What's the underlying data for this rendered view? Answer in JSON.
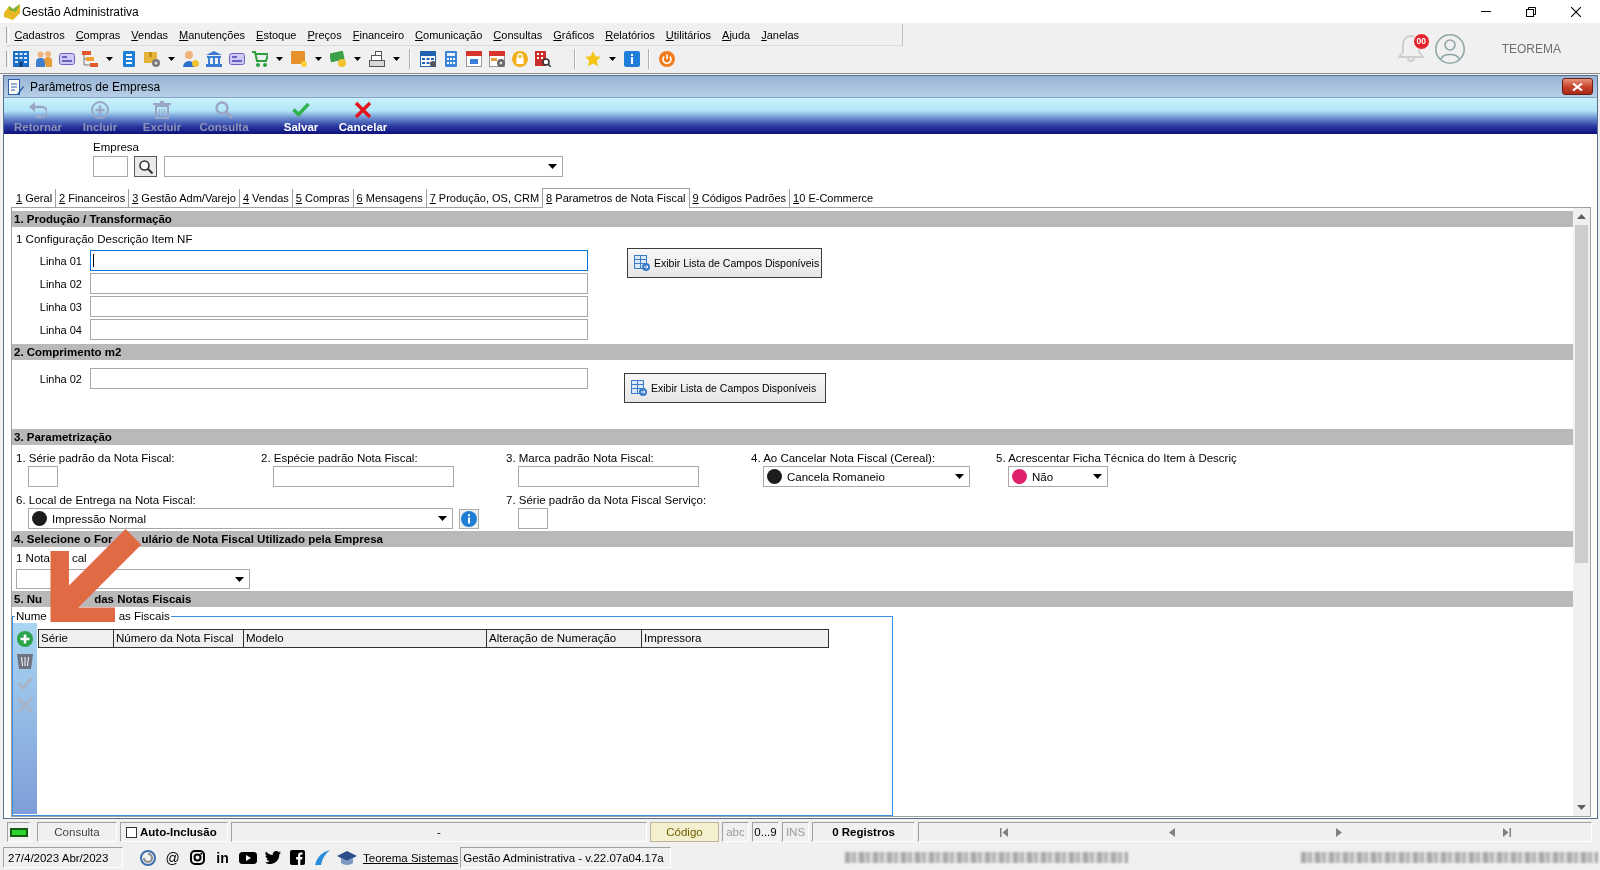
{
  "window": {
    "title": "Gestão Administrativa"
  },
  "menu": [
    "Cadastros",
    "Compras",
    "Vendas",
    "Manutenções",
    "Estoque",
    "Preços",
    "Financeiro",
    "Comunicação",
    "Consultas",
    "Gráficos",
    "Relatórios",
    "Utilitários",
    "Ajuda",
    "Janelas"
  ],
  "header": {
    "notification_count": "00",
    "user": "TEOREMA"
  },
  "child_window": {
    "title": "Parâmetros de Empresa",
    "actions": [
      {
        "kind": "back",
        "label": "Retornar",
        "disabled": true
      },
      {
        "kind": "add",
        "label": "Incluir",
        "disabled": true
      },
      {
        "kind": "delete",
        "label": "Excluir",
        "disabled": true
      },
      {
        "kind": "search",
        "label": "Consulta",
        "disabled": true
      },
      {
        "kind": "save",
        "label": "Salvar",
        "disabled": false
      },
      {
        "kind": "cancel",
        "label": "Cancelar",
        "disabled": false
      }
    ]
  },
  "company": {
    "label": "Empresa"
  },
  "tabs": [
    {
      "label": "1 Geral",
      "selected": false
    },
    {
      "label": "2 Financeiros",
      "selected": false
    },
    {
      "label": "3 Gestão Adm/Varejo",
      "selected": false
    },
    {
      "label": "4 Vendas",
      "selected": false
    },
    {
      "label": "5 Compras",
      "selected": false
    },
    {
      "label": "6 Mensagens",
      "selected": false
    },
    {
      "label": "7 Produção, OS, CRM",
      "selected": false
    },
    {
      "label": "8 Parametros de Nota Fiscal",
      "selected": true
    },
    {
      "label": "9 Códigos Padrões",
      "selected": false
    },
    {
      "label": "10 E-Commerce",
      "selected": false
    }
  ],
  "production": {
    "title": "1. Produção / Transformação",
    "subtitle": "1 Configuração Descrição Item NF",
    "lines": [
      {
        "label": "Linha 01",
        "focused": true
      },
      {
        "label": "Linha 02",
        "focused": false
      },
      {
        "label": "Linha 03",
        "focused": false
      },
      {
        "label": "Linha 04",
        "focused": false
      }
    ],
    "button": "Exibir Lista de Campos Disponíveis"
  },
  "length": {
    "title": "2. Comprimento m2",
    "lines": [
      {
        "label": "Linha 02",
        "focused": false
      }
    ],
    "button": "Exibir Lista de Campos Disponíveis"
  },
  "parametrization": {
    "title": "3. Parametrização",
    "rows": [
      {
        "fields": [
          {
            "kind": "text",
            "label": "1. Série padrão da Nota Fiscal:"
          },
          {
            "kind": "text",
            "label": "2. Espécie padrão Nota Fiscal:"
          },
          {
            "kind": "text",
            "label": "3. Marca padrão Nota Fiscal:"
          },
          {
            "kind": "combo",
            "label": "4. Ao Cancelar Nota Fiscal (Cereal):",
            "value": "Cancela Romaneio",
            "color": "#1c1c1c"
          },
          {
            "kind": "combo",
            "label": "5. Acrescentar Ficha Técnica do Item à Descriç",
            "value": "Não",
            "color": "#e0206e"
          }
        ]
      },
      {
        "fields": [
          {
            "kind": "combo",
            "label": "6. Local de Entrega na Nota Fiscal:",
            "value": "Impressão Normal",
            "color": "#1c1c1c",
            "info_button": true
          },
          {
            "kind": "text",
            "label": "7. Série padrão da Nota Fiscal Serviço:"
          }
        ]
      }
    ]
  },
  "form_selection": {
    "title_parts": [
      "4. Selecione o For",
      "ulário de Nota Fiscal Utilizado pela Empresa"
    ],
    "label_parts": [
      "1 Nota",
      "cal"
    ]
  },
  "numbering": {
    "title_parts": [
      "5. Nu",
      "das Notas Fiscais"
    ],
    "group_caption_parts": [
      "Nume",
      "as Fiscais"
    ],
    "tools": [
      {
        "kind": "add",
        "disabled": false
      },
      {
        "kind": "delete",
        "disabled": false
      },
      {
        "kind": "confirm",
        "disabled": true
      },
      {
        "kind": "cancel",
        "disabled": true
      }
    ],
    "columns": [
      "Série",
      "Número da Nota Fiscal",
      "Modelo",
      "Alteração de Numeração",
      "Impressora"
    ]
  },
  "status_bar": {
    "mode": "Consulta",
    "auto_inclusion": {
      "label": "Auto-Inclusão",
      "checked": false
    },
    "message": "-",
    "key_field": "Código",
    "indicators": [
      {
        "label": "abc",
        "on": false
      },
      {
        "label": "0...9",
        "on": true
      },
      {
        "label": "INS",
        "on": false
      }
    ],
    "records": "0 Registros"
  },
  "footer": {
    "date": "27/4/2023 Abr/2023",
    "links": [
      {
        "kind": "logo"
      },
      {
        "kind": "email",
        "text": "@"
      },
      {
        "kind": "instagram"
      },
      {
        "kind": "linkedin",
        "text": "in"
      },
      {
        "kind": "youtube"
      },
      {
        "kind": "twitter"
      },
      {
        "kind": "facebook"
      },
      {
        "kind": "swoosh"
      }
    ],
    "company_link": "Teorema Sistemas",
    "version": "Gestão Administrativa - v.22.07a04.17a"
  }
}
